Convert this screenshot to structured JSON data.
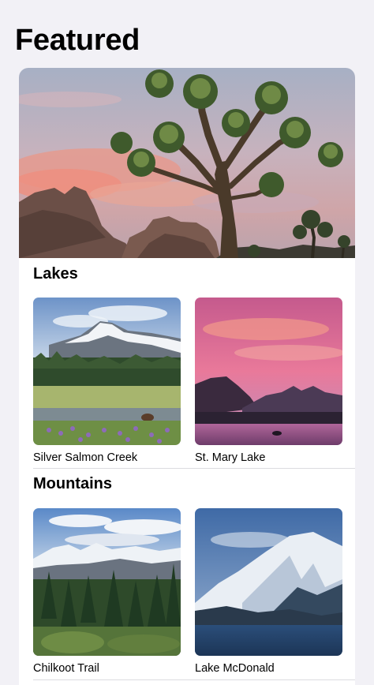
{
  "header": {
    "title": "Featured"
  },
  "sections": [
    {
      "title": "Lakes",
      "items": [
        {
          "caption": "Silver Salmon Creek",
          "image": "landscape-photo"
        },
        {
          "caption": "St. Mary Lake",
          "image": "landscape-photo"
        }
      ]
    },
    {
      "title": "Mountains",
      "items": [
        {
          "caption": "Chilkoot Trail",
          "image": "landscape-photo"
        },
        {
          "caption": "Lake McDonald",
          "image": "landscape-photo"
        }
      ]
    }
  ],
  "colors": {
    "background": "#f2f1f6",
    "card": "#ffffff",
    "divider": "#dcdce0"
  }
}
